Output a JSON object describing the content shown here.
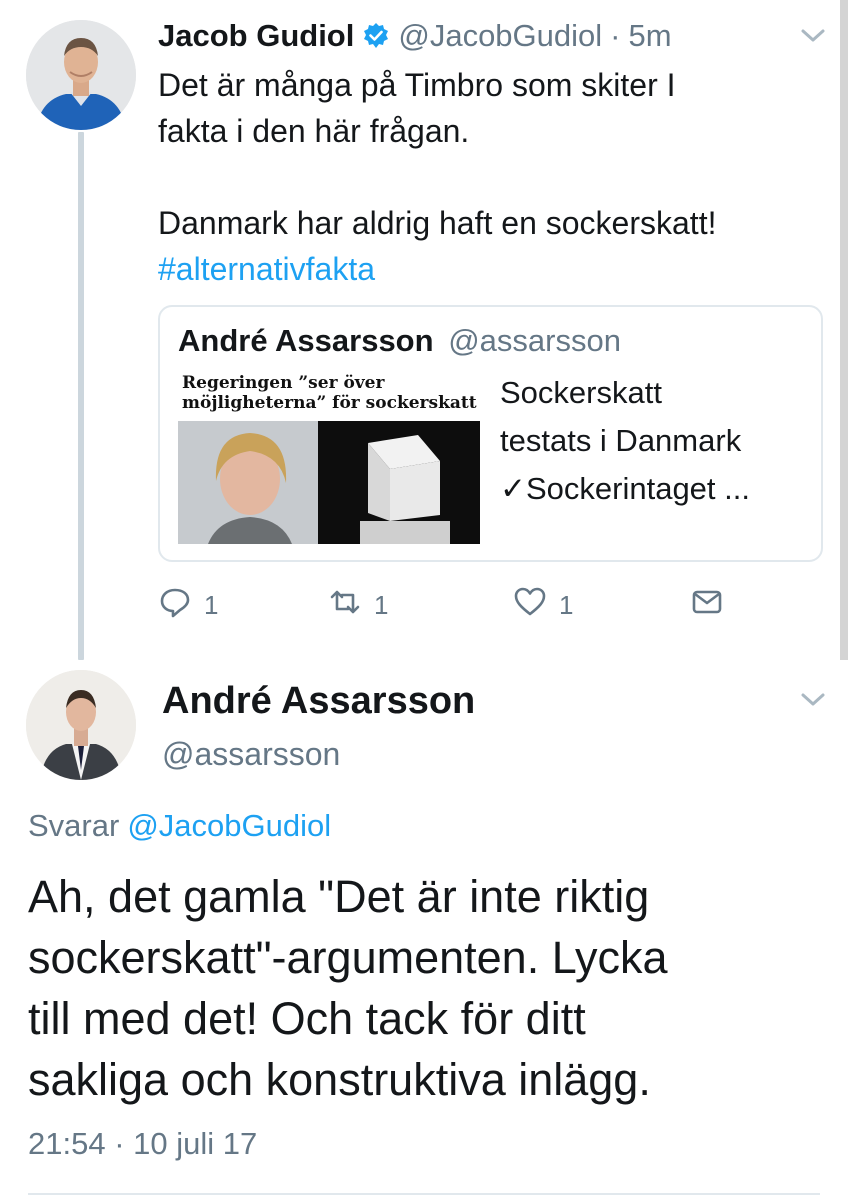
{
  "tweet1": {
    "name": "Jacob Gudiol",
    "handle": "@JacobGudiol",
    "separator": "·",
    "time": "5m",
    "lines": [
      "Det är många på Timbro som skiter I",
      "fakta i den här frågan.",
      "",
      "Danmark har aldrig haft en sockerskatt!"
    ],
    "hashtag": "#alternativfakta",
    "quote": {
      "name": "André Assarsson",
      "handle": "@assarsson",
      "thumbnail_headline": "Regeringen ”ser över möjligheterna” för sockerskatt",
      "lines": [
        "Sockerskatt",
        "testats i Danmark",
        "✓Sockerintaget ..."
      ]
    },
    "actions": {
      "reply_count": "1",
      "retweet_count": "1",
      "like_count": "1"
    }
  },
  "tweet2": {
    "name": "André Assarsson",
    "handle": "@assarsson",
    "replying_label": "Svarar",
    "replying_to": "@JacobGudiol",
    "lines": [
      "Ah, det gamla \"Det är inte riktig",
      "sockerskatt\"-argumenten. Lycka",
      "till med det! Och tack för ditt",
      "sakliga och konstruktiva inlägg."
    ],
    "timestamp": "21:54 · 10 juli 17"
  },
  "colors": {
    "link": "#1da1f2",
    "muted": "#657786",
    "text": "#14171a",
    "border": "#e1e8ed"
  },
  "icons": [
    "verified-badge-icon",
    "caret-down-icon",
    "reply-icon",
    "retweet-icon",
    "like-icon",
    "direct-message-icon"
  ]
}
